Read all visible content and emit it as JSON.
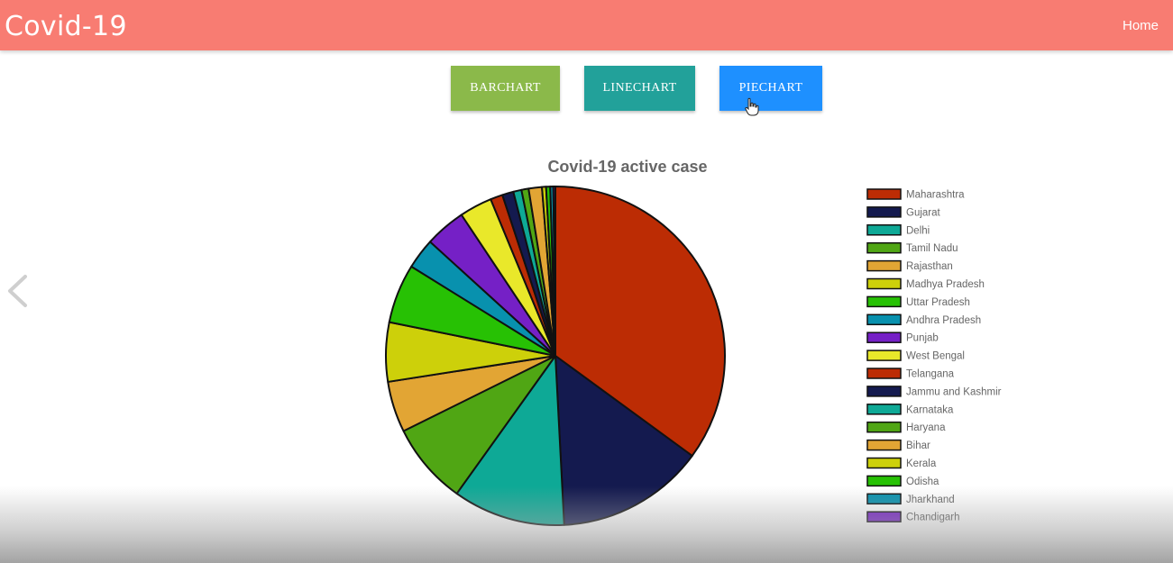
{
  "nav": {
    "brand": "Covid-19",
    "home": "Home"
  },
  "buttons": {
    "bar": "BARCHART",
    "line": "LINECHART",
    "pie": "PIECHART"
  },
  "chart_data": {
    "type": "pie",
    "title": "Covid-19 active case",
    "legend_position": "right",
    "categories": [
      "Maharashtra",
      "Gujarat",
      "Delhi",
      "Tamil Nadu",
      "Rajasthan",
      "Madhya Pradesh",
      "Uttar Pradesh",
      "Andhra Pradesh",
      "Punjab",
      "West Bengal",
      "Telangana",
      "Jammu and Kashmir",
      "Karnataka",
      "Haryana",
      "Bihar",
      "Kerala",
      "Odisha",
      "Jharkhand",
      "Chandigarh"
    ],
    "values": [
      36.0,
      14.5,
      11.0,
      8.0,
      5.0,
      5.8,
      5.8,
      3.0,
      4.0,
      3.2,
      1.2,
      1.1,
      0.8,
      0.7,
      1.3,
      0.4,
      0.4,
      0.3,
      0.2
    ],
    "colors": [
      "#bc2c04",
      "#141a4f",
      "#0ea996",
      "#50a614",
      "#e2a534",
      "#cdd00a",
      "#27c104",
      "#0891ae",
      "#7520c6",
      "#e9e82a",
      "#bc2c04",
      "#141a4f",
      "#0ea996",
      "#50a614",
      "#e2a534",
      "#cdd00a",
      "#27c104",
      "#0891ae",
      "#7520c6"
    ]
  }
}
